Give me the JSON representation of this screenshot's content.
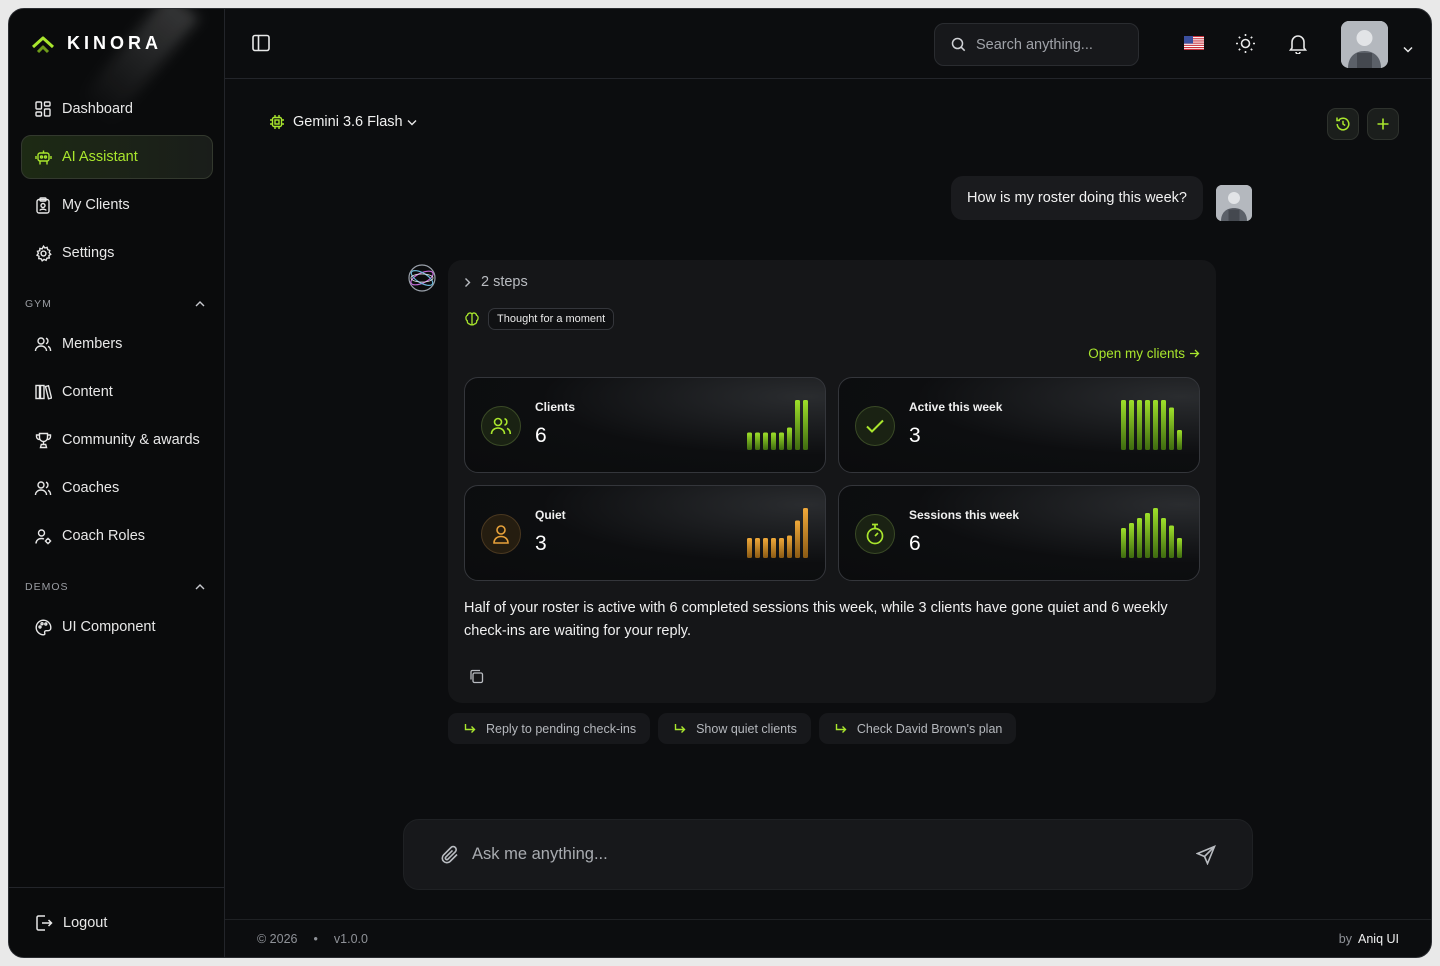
{
  "brand": {
    "name": "KINORA",
    "accent": "#a9e62d",
    "amber": "#e8a23a"
  },
  "sidebar": {
    "items": [
      {
        "label": "Dashboard",
        "icon": "dashboard-icon",
        "active": false
      },
      {
        "label": "AI Assistant",
        "icon": "robot-icon",
        "active": true
      },
      {
        "label": "My Clients",
        "icon": "clipboard-user-icon",
        "active": false
      },
      {
        "label": "Settings",
        "icon": "gear-icon",
        "active": false
      }
    ],
    "sections": [
      {
        "title": "GYM",
        "items": [
          {
            "label": "Members",
            "icon": "users-icon"
          },
          {
            "label": "Content",
            "icon": "library-icon"
          },
          {
            "label": "Community & awards",
            "icon": "trophy-icon"
          },
          {
            "label": "Coaches",
            "icon": "users-icon"
          },
          {
            "label": "Coach Roles",
            "icon": "user-gear-icon"
          }
        ]
      },
      {
        "title": "DEMOS",
        "items": [
          {
            "label": "UI Component",
            "icon": "palette-icon"
          }
        ]
      }
    ],
    "logout": "Logout"
  },
  "header": {
    "search_placeholder": "Search anything...",
    "flag": "us-flag-icon"
  },
  "chat": {
    "model": "Gemini 3.6 Flash",
    "user_message": "How is my roster doing this week?",
    "steps": "2 steps",
    "thought": "Thought for a moment",
    "open_link": "Open my clients",
    "stats": [
      {
        "label": "Clients",
        "value": "6",
        "color": "green",
        "icon": "users-icon",
        "bars": [
          0.35,
          0.35,
          0.35,
          0.35,
          0.35,
          0.45,
          1.0,
          1.0
        ]
      },
      {
        "label": "Active this week",
        "value": "3",
        "color": "green",
        "icon": "check-icon",
        "bars": [
          1.0,
          1.0,
          1.0,
          1.0,
          1.0,
          1.0,
          0.85,
          0.4
        ]
      },
      {
        "label": "Quiet",
        "value": "3",
        "color": "amber",
        "icon": "user-icon",
        "bars": [
          0.4,
          0.4,
          0.4,
          0.4,
          0.4,
          0.45,
          0.75,
          1.0
        ]
      },
      {
        "label": "Sessions this week",
        "value": "6",
        "color": "green",
        "icon": "timer-icon",
        "bars": [
          0.6,
          0.7,
          0.8,
          0.9,
          1.0,
          0.8,
          0.65,
          0.4
        ]
      }
    ],
    "summary": "Half of your roster is active with 6 completed sessions this week, while 3 clients have gone quiet and 6 weekly check-ins are waiting for your reply.",
    "suggestions": [
      "Reply to pending check-ins",
      "Show quiet clients",
      "Check David Brown's plan"
    ],
    "composer_placeholder": "Ask me anything..."
  },
  "footer": {
    "copyright": "© 2026",
    "version": "v1.0.0",
    "by": "by",
    "credit": "Aniq UI"
  }
}
